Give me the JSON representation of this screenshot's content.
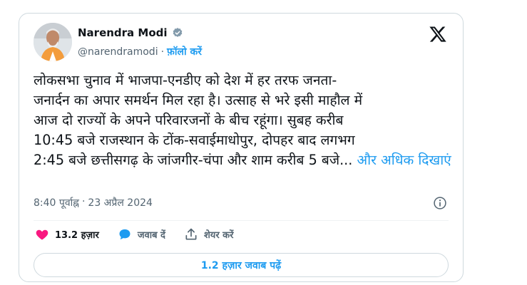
{
  "author": {
    "name": "Narendra Modi",
    "handle": "@narendramodi",
    "separator": "·",
    "follow_label": "फ़ॉलो करें"
  },
  "tweet": {
    "text": "लोकसभा चुनाव में भाजपा-एनडीए को देश में हर तरफ जनता-\nजनार्दन का अपार समर्थन मिल रहा है। उत्साह से भरे इसी माहौल में\nआज दो राज्यों के अपने परिवारजनों के बीच रहूंगा। सुबह करीब\n10:45 बजे राजस्थान के टोंक-सवाईमाधोपुर, दोपहर बाद लगभग\n2:45 बजे छत्तीसगढ़ के जांजगीर-चंपा और शाम करीब 5 बजे...",
    "show_more": "और अधिक दिखाएं"
  },
  "meta": {
    "time": "8:40 पूर्वाह्न",
    "separator": "·",
    "date": "23 अप्रैल 2024"
  },
  "actions": {
    "likes": "13.2 हज़ार",
    "reply": "जवाब दें",
    "share": "शेयर करें"
  },
  "replies_button": "1.2 हज़ार जवाब पढ़ें",
  "colors": {
    "accent": "#1d9bf0",
    "like": "#f91880",
    "text": "#0f1419",
    "secondary": "#536471",
    "border": "#cfd9de"
  },
  "icons": [
    "verified-badge-icon",
    "x-logo-icon",
    "info-icon",
    "heart-icon",
    "reply-bubble-icon",
    "share-icon"
  ]
}
